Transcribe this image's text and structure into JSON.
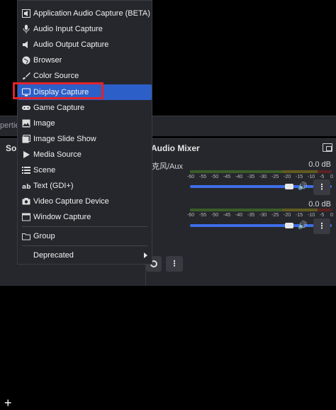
{
  "background": {
    "properties_tab": "pertie",
    "sources_title": "Sou",
    "audio_mixer_title": "Audio Mixer",
    "tracks": [
      {
        "name": "克风/Aux",
        "db": "0.0 dB"
      },
      {
        "name": "",
        "db": "0.0 dB"
      }
    ],
    "meter_scale": [
      "-60",
      "-55",
      "-50",
      "-45",
      "-40",
      "-35",
      "-30",
      "-25",
      "-20",
      "-15",
      "-10",
      "-5",
      "0"
    ],
    "add_label": "+",
    "kebab_label": "⋮"
  },
  "menu": {
    "items": [
      {
        "label": "Application Audio Capture (BETA)",
        "icon": "app-audio-icon"
      },
      {
        "label": "Audio Input Capture",
        "icon": "microphone-icon"
      },
      {
        "label": "Audio Output Capture",
        "icon": "speaker-icon"
      },
      {
        "label": "Browser",
        "icon": "globe-icon"
      },
      {
        "label": "Color Source",
        "icon": "paint-brush-icon"
      },
      {
        "label": "Display Capture",
        "icon": "monitor-icon"
      },
      {
        "label": "Game Capture",
        "icon": "gamepad-icon"
      },
      {
        "label": "Image",
        "icon": "image-icon"
      },
      {
        "label": "Image Slide Show",
        "icon": "slideshow-icon"
      },
      {
        "label": "Media Source",
        "icon": "play-icon"
      },
      {
        "label": "Scene",
        "icon": "list-icon"
      },
      {
        "label": "Text (GDI+)",
        "icon": "text-icon"
      },
      {
        "label": "Video Capture Device",
        "icon": "camera-icon"
      },
      {
        "label": "Window Capture",
        "icon": "window-icon"
      }
    ],
    "group_label": "Group",
    "deprecated_label": "Deprecated",
    "selected_index": 5,
    "accent_color": "#2d5fc8",
    "highlight_color": "#e0232c"
  }
}
